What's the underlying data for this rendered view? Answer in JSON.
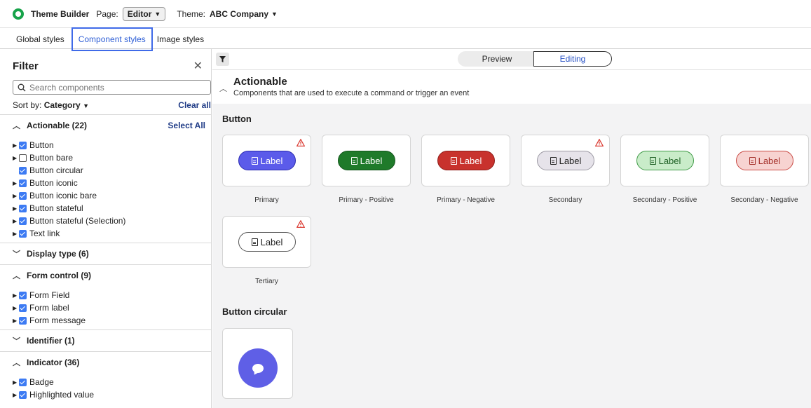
{
  "topbar": {
    "app_title": "Theme Builder",
    "page_label": "Page:",
    "page_value": "Editor",
    "theme_label": "Theme:",
    "theme_value": "ABC Company"
  },
  "tabs": [
    {
      "label": "Global styles"
    },
    {
      "label": "Component styles"
    },
    {
      "label": "Image styles"
    }
  ],
  "filter": {
    "title": "Filter",
    "search_placeholder": "Search components",
    "sort_label": "Sort by:",
    "sort_value": "Category",
    "clear_all": "Clear all",
    "select_all": "Select All",
    "groups": [
      {
        "label": "Actionable (22)",
        "items": [
          {
            "label": "Button",
            "checked": true
          },
          {
            "label": "Button bare",
            "checked": false
          },
          {
            "label": "Button circular",
            "checked": true
          },
          {
            "label": "Button iconic",
            "checked": true
          },
          {
            "label": "Button iconic bare",
            "checked": true
          },
          {
            "label": "Button stateful",
            "checked": true
          },
          {
            "label": "Button stateful (Selection)",
            "checked": true
          },
          {
            "label": "Text link",
            "checked": true
          }
        ]
      },
      {
        "label": "Display type (6)"
      },
      {
        "label": "Form control (9)",
        "items": [
          {
            "label": "Form Field",
            "checked": true
          },
          {
            "label": "Form label",
            "checked": true
          },
          {
            "label": "Form message",
            "checked": true
          }
        ]
      },
      {
        "label": "Identifier (1)"
      },
      {
        "label": "Indicator (36)",
        "items": [
          {
            "label": "Badge",
            "checked": true
          },
          {
            "label": "Highlighted value",
            "checked": true
          }
        ]
      }
    ]
  },
  "view_toggle": {
    "preview": "Preview",
    "editing": "Editing",
    "selected": "Editing"
  },
  "section": {
    "title": "Actionable",
    "description": "Components that are used to execute a command or trigger an event"
  },
  "button_group": {
    "title": "Button",
    "pill_label": "Label",
    "variants": [
      {
        "name": "Primary",
        "bg": "#5b5bea",
        "fg": "#ffffff",
        "border": "#2b2bb0",
        "warning": true
      },
      {
        "name": "Primary - Positive",
        "bg": "#1f7a2a",
        "fg": "#ffffff",
        "border": "#14551c",
        "warning": false
      },
      {
        "name": "Primary - Negative",
        "bg": "#c8322d",
        "fg": "#ffffff",
        "border": "#8f1f1b",
        "warning": false
      },
      {
        "name": "Secondary",
        "bg": "#e6e3ea",
        "fg": "#222222",
        "border": "#9b98a2",
        "warning": true
      },
      {
        "name": "Secondary - Positive",
        "bg": "#c9ecc9",
        "fg": "#1d5f23",
        "border": "#3f9a46",
        "warning": false
      },
      {
        "name": "Secondary - Negative",
        "bg": "#f7d3d1",
        "fg": "#a4302a",
        "border": "#c94a44",
        "warning": false
      },
      {
        "name": "Tertiary",
        "bg": "#ffffff",
        "fg": "#222222",
        "border": "#555555",
        "warning": true
      }
    ]
  },
  "button_circular_group": {
    "title": "Button circular",
    "icon": "chat-bubble-icon",
    "bg": "#5f5fe6"
  },
  "colors": {
    "accent": "#3f6ae8",
    "warning": "#d9342b",
    "checkbox": "#3d7bf3"
  }
}
